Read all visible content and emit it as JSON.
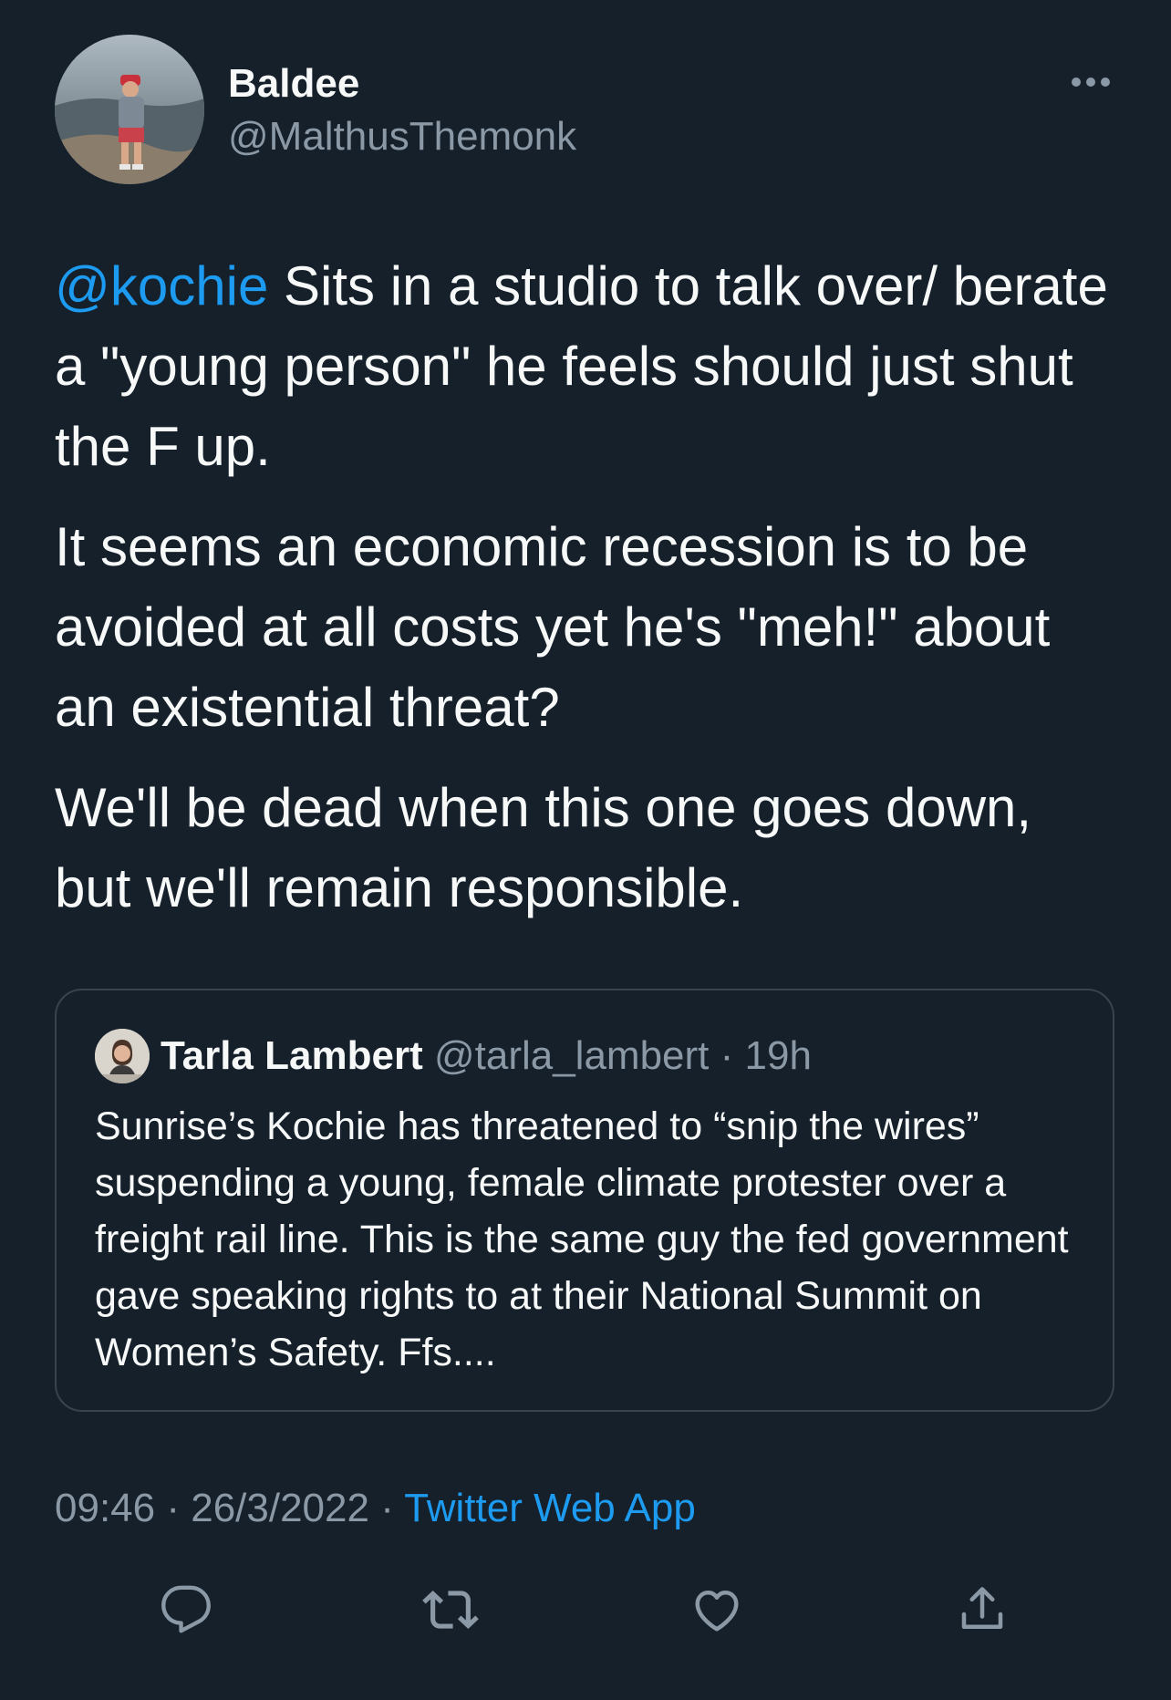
{
  "author": {
    "name": "Baldee",
    "handle": "@MalthusThemonk",
    "avatar_icon": "profile-photo-person-on-mountain"
  },
  "tweet": {
    "mention": "@kochie",
    "paragraph1_rest": " Sits in a studio to talk over/ berate a \"young person\" he feels should just shut the F up.",
    "paragraph2": "It seems an economic recession is to be avoided at all costs yet he's \"meh!\" about an existential threat?",
    "paragraph3": "We'll be dead when this one goes down, but we'll remain responsible."
  },
  "quoted_tweet": {
    "name": "Tarla Lambert",
    "handle": "@tarla_lambert",
    "separator": " · ",
    "time_ago": "19h",
    "text": "Sunrise’s Kochie has threatened to “snip the wires” suspending a young, female climate protester over a freight rail line. This is the same guy the fed government gave speaking rights to at their National Summit on Women’s Safety. Ffs...."
  },
  "meta": {
    "time": "09:46",
    "sep1": " · ",
    "date": "26/3/2022",
    "sep2": " · ",
    "source": "Twitter Web App"
  },
  "actions": {
    "reply_icon": "reply-icon",
    "retweet_icon": "retweet-icon",
    "like_icon": "heart-icon",
    "share_icon": "share-icon"
  },
  "colors": {
    "background": "#15202b",
    "text": "#f7f9f9",
    "secondary": "#8b98a5",
    "accent": "#1d9bf0",
    "border": "#38444d"
  }
}
